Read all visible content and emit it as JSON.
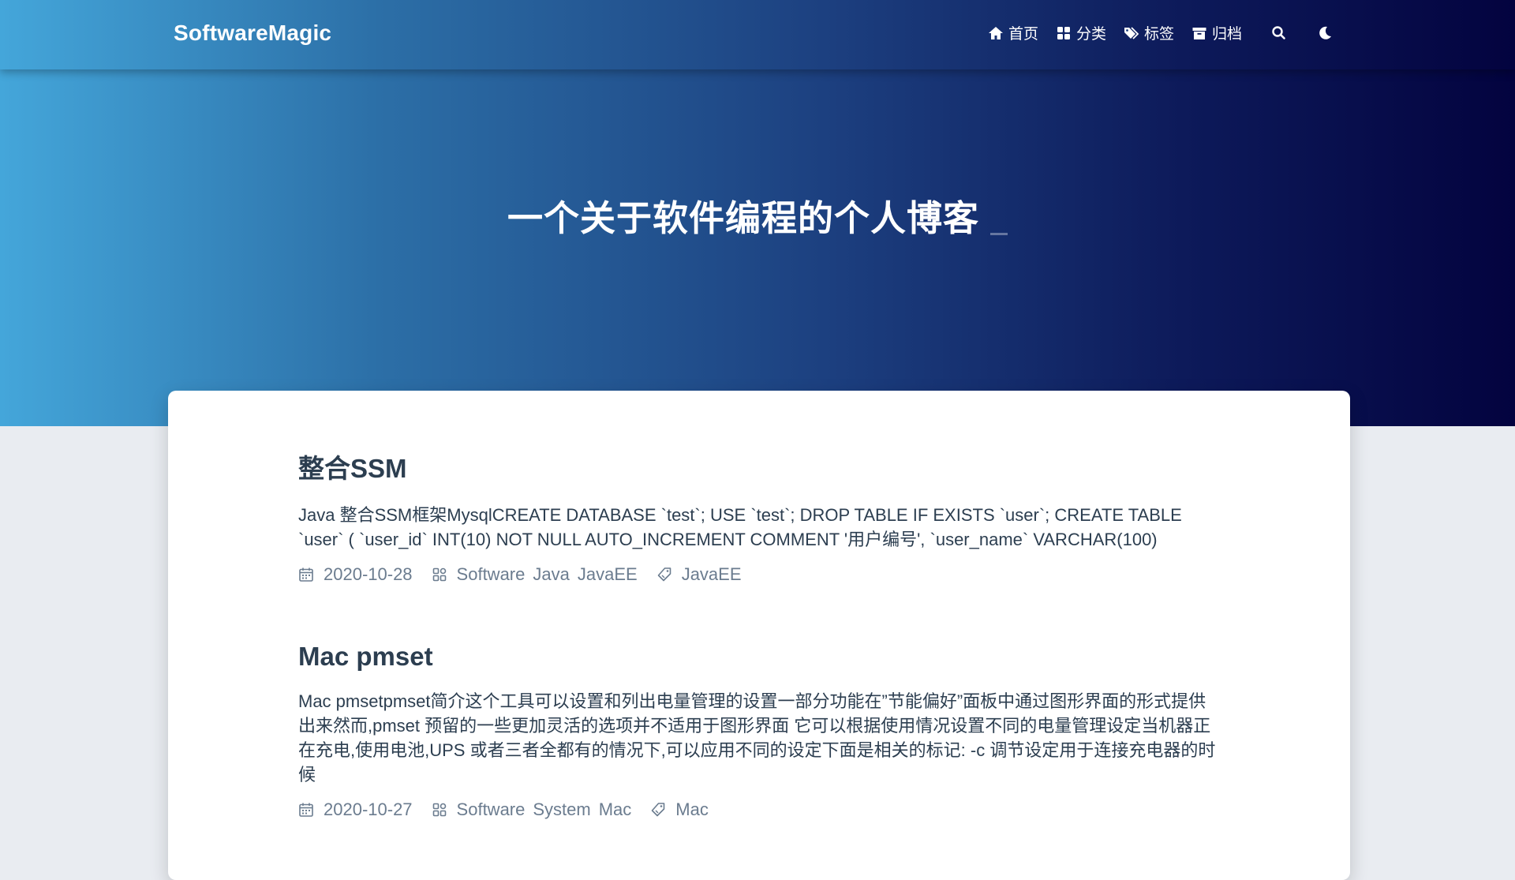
{
  "site": {
    "brand": "SoftwareMagic",
    "tagline": "一个关于软件编程的个人博客"
  },
  "nav": {
    "items": [
      {
        "label": "首页",
        "icon": "home-icon"
      },
      {
        "label": "分类",
        "icon": "grid-icon"
      },
      {
        "label": "标签",
        "icon": "tags-icon"
      },
      {
        "label": "归档",
        "icon": "archive-icon"
      }
    ],
    "search_icon": "search-icon",
    "theme_icon": "moon-icon"
  },
  "posts": [
    {
      "title": "整合SSM",
      "excerpt": "Java 整合SSM框架MysqlCREATE DATABASE `test`; USE `test`; DROP TABLE IF EXISTS `user`; CREATE TABLE `user` ( `user_id` INT(10) NOT NULL AUTO_INCREMENT COMMENT '用户编号', `user_name` VARCHAR(100)",
      "date": "2020-10-28",
      "categories": [
        "Software",
        "Java",
        "JavaEE"
      ],
      "tags": [
        "JavaEE"
      ]
    },
    {
      "title": "Mac pmset",
      "excerpt": "Mac pmsetpmset简介这个工具可以设置和列出电量管理的设置一部分功能在”节能偏好”面板中通过图形界面的形式提供出来然而,pmset 预留的一些更加灵活的选项并不适用于图形界面 它可以根据使用情况设置不同的电量管理设定当机器正在充电,使用电池,UPS 或者三者全都有的情况下,可以应用不同的设定下面是相关的标记: -c 调节设定用于连接充电器的时候",
      "date": "2020-10-27",
      "categories": [
        "Software",
        "System",
        "Mac"
      ],
      "tags": [
        "Mac"
      ]
    }
  ],
  "colors": {
    "hero_start": "#44a6da",
    "hero_end": "#03033f",
    "title_text": "#2c3e50",
    "meta_text": "#6b7c8f",
    "page_bg": "#e9ecf1"
  }
}
